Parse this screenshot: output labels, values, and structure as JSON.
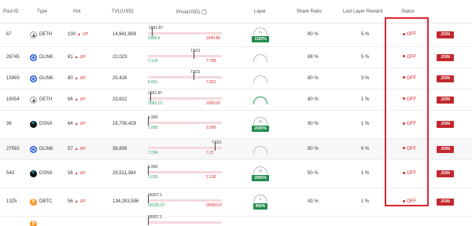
{
  "headers": {
    "pool_id": "Pool ID",
    "type": "Type",
    "hot": "Hot",
    "tvl": "TVL(USD)",
    "price": "Price(USD)",
    "layer": "Layer",
    "share_ratio": "Share Ratio",
    "last_layer_reward": "Last Layer Reward",
    "status": "Status"
  },
  "badges": {
    "up": "UP",
    "join": "JOIN",
    "status_off": "OFF"
  },
  "rows": [
    {
      "pool_id": "67",
      "type": "DETH",
      "coin": "eth",
      "hot": "100",
      "tvl": "14,641,869",
      "price_top": "1591.87",
      "price_min": "1588.9",
      "price_max": "1640.86",
      "layer_top": "11",
      "layer_pct": "1100%",
      "share": "80 %",
      "reward": "5 %"
    },
    {
      "pool_id": "26745",
      "type": "DLINK",
      "coin": "link",
      "hot": "81",
      "tvl": "22,023",
      "price_top": "7.521",
      "price_min": "7.134",
      "price_max": "7.768",
      "layer_top": "",
      "layer_pct": "",
      "share": "88 %",
      "reward": "5 %"
    },
    {
      "pool_id": "15993",
      "type": "DLINK",
      "coin": "link",
      "hot": "80",
      "tvl": "25,426",
      "price_top": "7.521",
      "price_min": "6.811",
      "price_max": "7.821",
      "layer_top": "",
      "layer_pct": "",
      "share": "80 %",
      "reward": "3 %"
    },
    {
      "pool_id": "16054",
      "type": "DETH",
      "coin": "eth",
      "hot": "66",
      "tvl": "23,622",
      "price_top": "1591.87",
      "price_min": "1583.13",
      "price_max": "1699.02",
      "layer_top": "",
      "layer_pct": "",
      "share": "80 %",
      "reward": "1 %"
    },
    {
      "pool_id": "36",
      "type": "DSNX",
      "coin": "snx",
      "hot": "64",
      "tvl": "18,708,429",
      "price_top": "1.992",
      "price_min": "1.995",
      "price_max": "2.095",
      "layer_top": "20",
      "layer_pct": "2000%",
      "share": "90 %",
      "reward": "1 %"
    },
    {
      "pool_id": "27593",
      "type": "DLINK",
      "coin": "link",
      "hot": "57",
      "tvl": "38,899",
      "price_top": "7.521",
      "price_min": "7.234",
      "price_max": "7.27",
      "layer_top": "",
      "layer_pct": "",
      "share": "90 %",
      "reward": "6 %"
    },
    {
      "pool_id": "543",
      "type": "DSNX",
      "coin": "snx",
      "hot": "56",
      "tvl": "29,511,384",
      "price_top": "1.992",
      "price_min": "2.025",
      "price_max": "2.126",
      "layer_top": "20",
      "layer_pct": "2000%",
      "share": "50 %",
      "reward": "1 %"
    },
    {
      "pool_id": "1325",
      "type": "DBTC",
      "coin": "btc",
      "hot": "56",
      "tvl": "134,283,596",
      "price_top": "26307.1",
      "price_min": "26328.23",
      "price_max": "26459.97",
      "layer_top": "9",
      "layer_pct": "900%",
      "share": "43 %",
      "reward": "1 %"
    },
    {
      "pool_id": "",
      "type": "",
      "coin": "btc",
      "hot": "",
      "tvl": "",
      "price_top": "26307.1",
      "price_min": "",
      "price_max": "",
      "layer_top": "",
      "layer_pct": "",
      "share": "",
      "reward": ""
    }
  ],
  "colors": {
    "accent_red": "#c0282d",
    "up_green": "#1f8b4c"
  },
  "icons": {
    "eth": "ethereum-icon",
    "link": "chainlink-icon",
    "snx": "synthetix-icon",
    "btc": "bitcoin-icon",
    "info": "info-icon",
    "flame": "flame-icon"
  }
}
